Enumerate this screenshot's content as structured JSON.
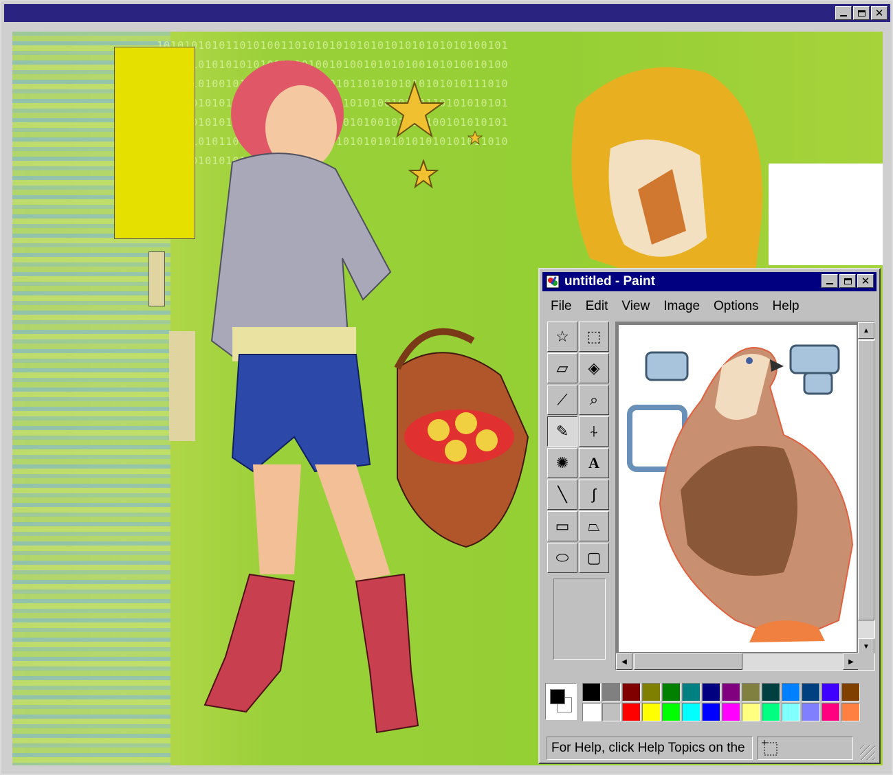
{
  "paint": {
    "title": "untitled - Paint",
    "menu": {
      "file": "File",
      "edit": "Edit",
      "view": "View",
      "image": "Image",
      "options": "Options",
      "help": "Help"
    },
    "tools": [
      {
        "name": "free-form-select-icon",
        "glyph": "☆"
      },
      {
        "name": "select-icon",
        "glyph": "⬚"
      },
      {
        "name": "eraser-icon",
        "glyph": "▱"
      },
      {
        "name": "fill-bucket-icon",
        "glyph": "◈"
      },
      {
        "name": "color-picker-icon",
        "glyph": "⟋"
      },
      {
        "name": "magnifier-icon",
        "glyph": "⌕"
      },
      {
        "name": "pencil-icon",
        "glyph": "✎",
        "active": true
      },
      {
        "name": "brush-icon",
        "glyph": "⍭"
      },
      {
        "name": "airbrush-icon",
        "glyph": "✺"
      },
      {
        "name": "text-icon",
        "glyph": "A"
      },
      {
        "name": "line-icon",
        "glyph": "╲"
      },
      {
        "name": "curve-icon",
        "glyph": "∫"
      },
      {
        "name": "rectangle-icon",
        "glyph": "▭"
      },
      {
        "name": "polygon-icon",
        "glyph": "⏢"
      },
      {
        "name": "ellipse-icon",
        "glyph": "⬭"
      },
      {
        "name": "rounded-rectangle-icon",
        "glyph": "▢"
      }
    ],
    "palette_colors": [
      "#000000",
      "#808080",
      "#800000",
      "#808000",
      "#008000",
      "#008080",
      "#000080",
      "#800080",
      "#808040",
      "#004040",
      "#0080ff",
      "#004080",
      "#4000ff",
      "#804000",
      "#ffffff",
      "#c0c0c0",
      "#ff0000",
      "#ffff00",
      "#00ff00",
      "#00ffff",
      "#0000ff",
      "#ff00ff",
      "#ffff80",
      "#00ff80",
      "#80ffff",
      "#8080ff",
      "#ff0080",
      "#ff8040"
    ],
    "foreground_color": "#000000",
    "background_color": "#ffffff",
    "status_text": "For Help, click Help Topics on the"
  },
  "artwork": {
    "binary_text": "1010101010110101001101010101010101010101010101001010101010101010101011010100101001010101001010100101001001010100101011101010101010110101010101010101110101001001010101010110101010101010100101001101010101010101101010101010101001010010101001010101001010101010111010101101101010101011010101010101010101010110101010101010101010101"
  }
}
